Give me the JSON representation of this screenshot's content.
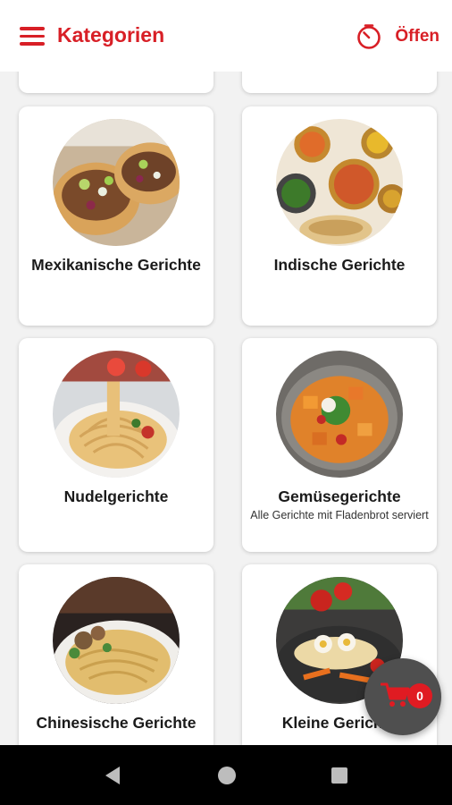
{
  "appbar": {
    "title": "Kategorien",
    "status_label": "Öffen",
    "menu_icon": "hamburger-menu-icon",
    "status_icon": "timer-icon"
  },
  "categories": [
    {
      "name": "Mexikanische Gerichte",
      "description": "",
      "image": "mexican-tacos-photo"
    },
    {
      "name": "Indische Gerichte",
      "description": "",
      "image": "indian-dishes-photo"
    },
    {
      "name": "Nudelgerichte",
      "description": "",
      "image": "pasta-photo"
    },
    {
      "name": "Gemüsegerichte",
      "description": "Alle Gerichte mit Fladenbrot serviert",
      "image": "vegetable-dish-photo"
    },
    {
      "name": "Chinesische Gerichte",
      "description": "",
      "image": "chinese-noodles-photo"
    },
    {
      "name": "Kleine Gerichte",
      "description": "",
      "image": "small-dish-photo"
    }
  ],
  "cart": {
    "count": "0",
    "icon": "cart-icon"
  },
  "navigation": {
    "back_icon": "back-icon",
    "home_icon": "home-icon",
    "recent_icon": "recent-apps-icon"
  },
  "colors": {
    "accent": "#d81f26",
    "fab": "#4f4f4f",
    "badge": "#e01b22",
    "background": "#f2f2f2"
  }
}
